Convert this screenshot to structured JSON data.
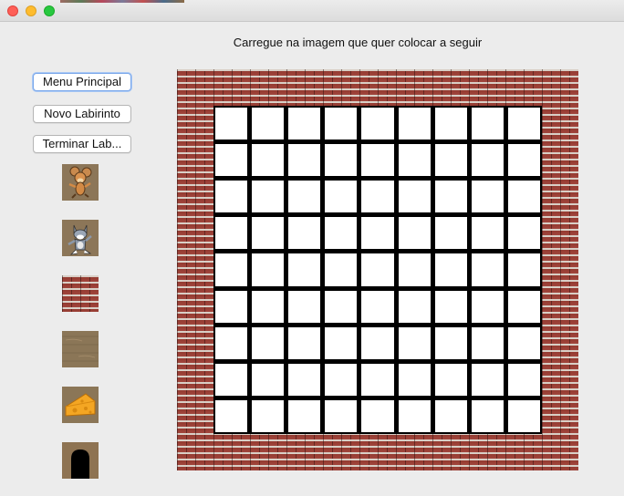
{
  "window": {
    "controls": [
      "close",
      "minimize",
      "maximize"
    ]
  },
  "instruction": "Carregue na imagem que quer colocar a seguir",
  "buttons": {
    "menu_principal": "Menu Principal",
    "novo_labirinto": "Novo Labirinto",
    "terminar": "Terminar Lab..."
  },
  "palette": [
    {
      "icon": "jerry-mouse-icon"
    },
    {
      "icon": "tom-cat-icon"
    },
    {
      "icon": "brick-wall-icon"
    },
    {
      "icon": "wood-floor-icon"
    },
    {
      "icon": "cheese-icon"
    },
    {
      "icon": "mouse-hole-icon"
    }
  ],
  "maze": {
    "rows": 9,
    "cols": 9,
    "border": "brick-wall",
    "cells": "empty"
  },
  "colors": {
    "cell": "#ffffff",
    "grid_line": "#000000",
    "brick": "#9b3a30"
  }
}
